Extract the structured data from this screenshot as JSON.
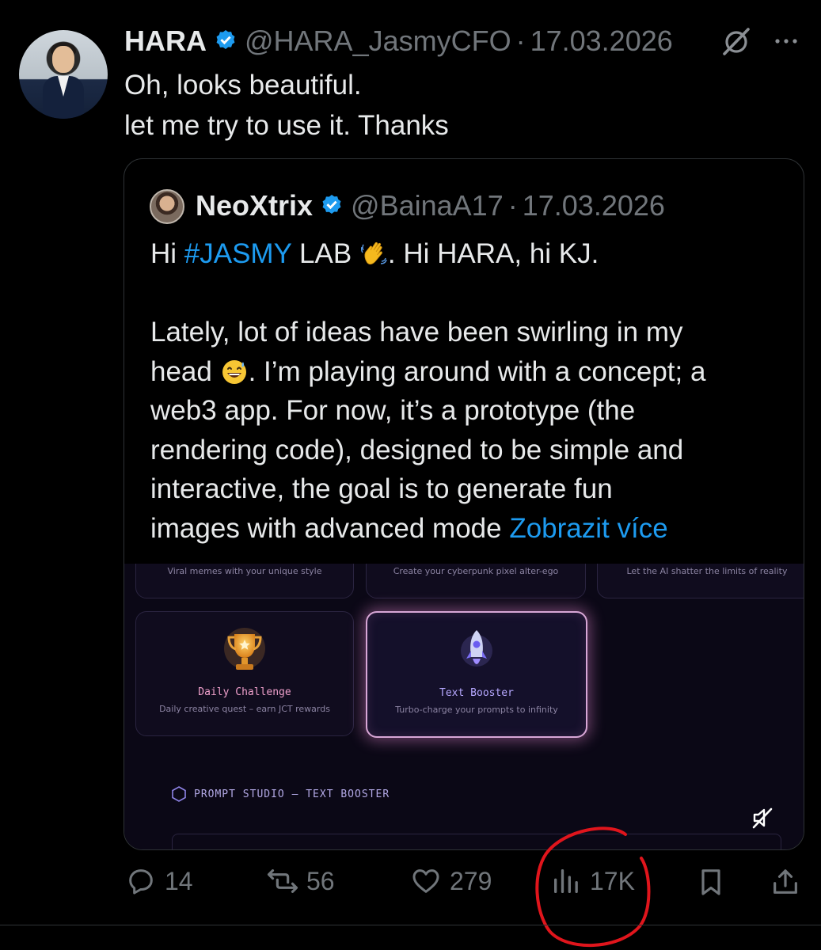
{
  "tweet": {
    "author_name": "HARA",
    "handle": "@HARA_JasmyCFO",
    "separator": "·",
    "date": "17.03.2026",
    "text_lines": [
      "Oh, looks beautiful.",
      "let me try to use it. Thanks"
    ]
  },
  "quote": {
    "author_name": "NeoXtrix",
    "handle": "@BainaA17",
    "separator": "·",
    "date": "17.03.2026",
    "line1_pre": "Hi ",
    "hashtag": "#JASMY",
    "line1_mid": " LAB ",
    "line1_post": ". Hi HARA, hi KJ.",
    "line3_a": "Lately, lot of ideas have been swirling in my",
    "line4_pre": "head ",
    "line4_post": ". I’m playing around with a concept; a",
    "line5": "web3 app. For now, it’s a prototype (the",
    "line6": "rendering code), designed to be simple  and",
    "line7": "interactive,  the goal is to  generate fun",
    "line8_pre": "images with advanced mode ",
    "show_more": "Zobrazit více",
    "media": {
      "top_cards": [
        "Viral memes with your unique style",
        "Create your cyberpunk pixel alter-ego",
        "Let the AI shatter the limits of reality"
      ],
      "daily_title": "Daily Challenge",
      "daily_sub": "Daily creative quest – earn JCT rewards",
      "booster_title": "Text Booster",
      "booster_sub": "Turbo-charge your prompts to infinity",
      "studio_label": "PROMPT STUDIO – TEXT BOOSTER"
    }
  },
  "actions": {
    "replies": "14",
    "reposts": "56",
    "likes": "279",
    "views": "17K"
  },
  "colors": {
    "background": "#000000",
    "text": "#e7e9ea",
    "muted": "#71767b",
    "link": "#1d9bf0",
    "annotation_circle": "#e0151c"
  }
}
